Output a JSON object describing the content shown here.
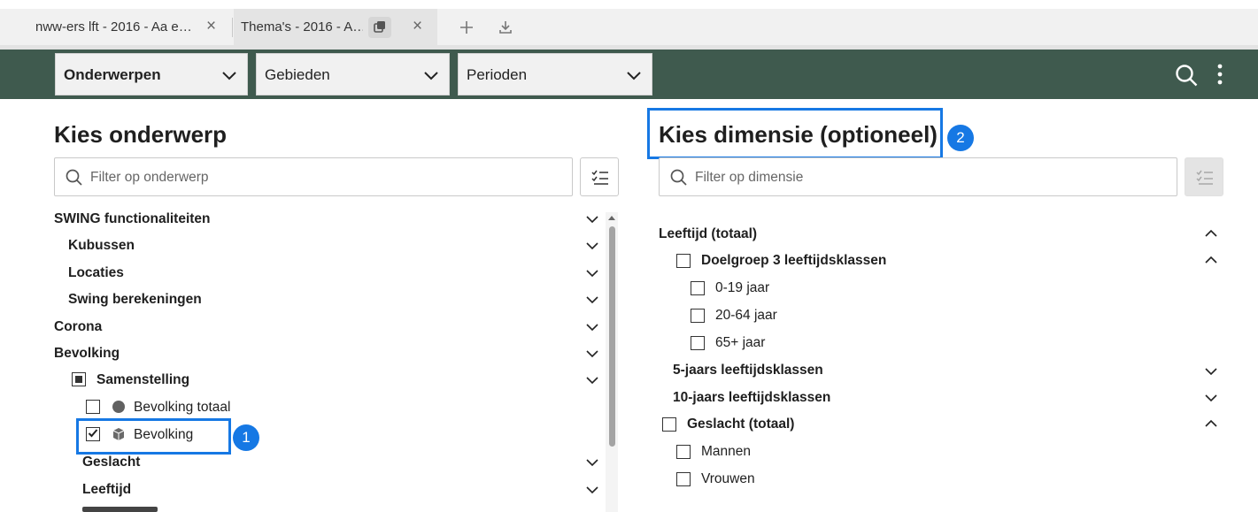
{
  "browser": {
    "tabs": [
      {
        "title": "nww-ers lft - 2016 - Aa e…",
        "active": false
      },
      {
        "title": "Thema's - 2016 - A…",
        "active": true
      }
    ]
  },
  "toolbar": {
    "dropdowns": [
      "Onderwerpen",
      "Gebieden",
      "Perioden"
    ]
  },
  "left": {
    "title": "Kies onderwerp",
    "filter_placeholder": "Filter op onderwerp",
    "items": [
      {
        "label": "SWING functionaliteiten",
        "bold": true,
        "level": 0
      },
      {
        "label": "Kubussen",
        "bold": true,
        "level": 1
      },
      {
        "label": "Locaties",
        "bold": true,
        "level": 1
      },
      {
        "label": "Swing berekeningen",
        "bold": true,
        "level": 1
      },
      {
        "label": "Corona",
        "bold": true,
        "level": 0
      },
      {
        "label": "Bevolking",
        "bold": true,
        "level": 0
      },
      {
        "label": "Samenstelling",
        "bold": true,
        "level": 2,
        "checkbox": "partial"
      },
      {
        "label": "Bevolking totaal",
        "bold": false,
        "level": 3,
        "checkbox": "unchecked",
        "icon": "circle-icon"
      },
      {
        "label": "Bevolking",
        "bold": false,
        "level": 3,
        "checkbox": "checked",
        "icon": "cube-icon"
      },
      {
        "label": "Geslacht",
        "bold": true,
        "level": 2
      },
      {
        "label": "Leeftijd",
        "bold": true,
        "level": 2
      }
    ]
  },
  "right": {
    "title": "Kies dimensie (optioneel)",
    "filter_placeholder": "Filter op dimensie",
    "items": [
      {
        "label": "Leeftijd (totaal)",
        "bold": true
      },
      {
        "label": "Doelgroep 3 leeftijdsklassen",
        "bold": true
      },
      {
        "label": "0-19 jaar",
        "bold": false
      },
      {
        "label": "20-64 jaar",
        "bold": false
      },
      {
        "label": "65+ jaar",
        "bold": false
      },
      {
        "label": "5-jaars leeftijdsklassen",
        "bold": true
      },
      {
        "label": "10-jaars leeftijdsklassen",
        "bold": true
      },
      {
        "label": "Geslacht (totaal)",
        "bold": true
      },
      {
        "label": "Mannen",
        "bold": false
      },
      {
        "label": "Vrouwen",
        "bold": false
      }
    ]
  },
  "annotations": [
    "1",
    "2"
  ],
  "colors": {
    "header": "#3f5a4e",
    "highlight": "#1678e4"
  }
}
